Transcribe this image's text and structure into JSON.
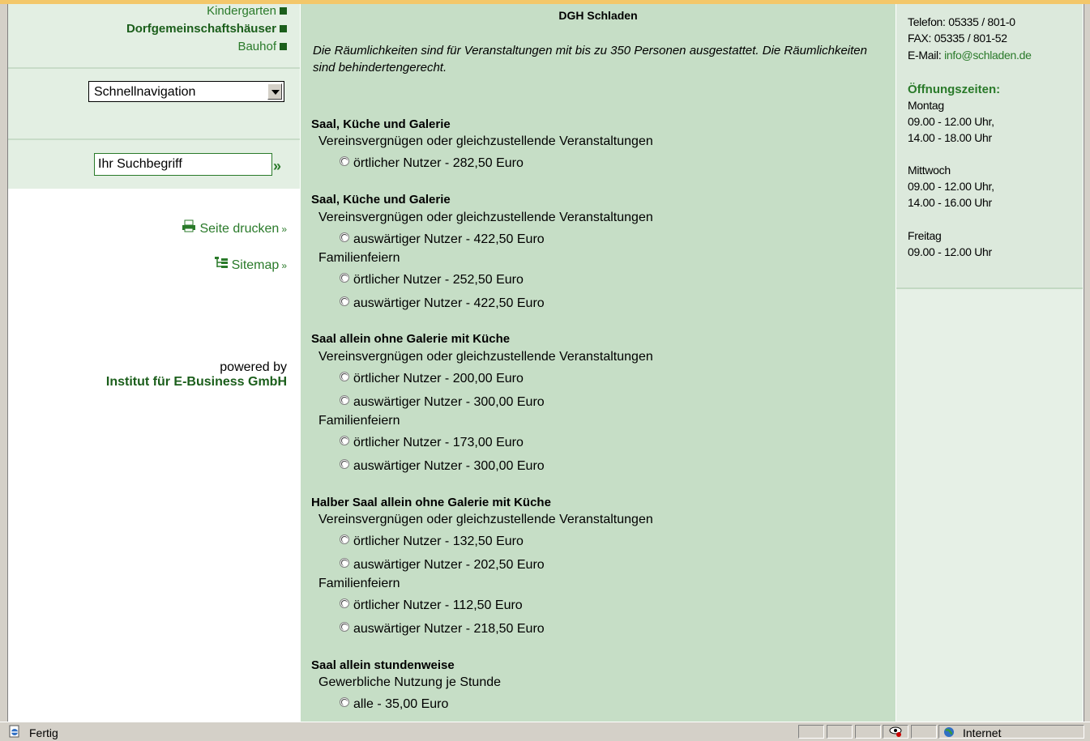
{
  "left_nav": {
    "items": [
      {
        "label": "Kindergarten",
        "active": false
      },
      {
        "label": "Dorfgemeinschaftshäuser",
        "active": true
      },
      {
        "label": "Bauhof",
        "active": false
      }
    ],
    "quick_nav": {
      "selected": "Schnellnavigation"
    },
    "search": {
      "value": "Ihr Suchbegriff",
      "go_label": "»"
    },
    "print_label": "Seite drucken",
    "sitemap_label": "Sitemap",
    "link_suffix": "»",
    "powered_by": "powered by",
    "company": "Institut für E-Business GmbH"
  },
  "content": {
    "title": "DGH Schladen",
    "intro": "Die Räumlichkeiten sind für Veranstaltungen mit bis zu 350 Personen ausgestattet. Die Räumlichkeiten sind behindertengerecht.",
    "sections": [
      {
        "heading": "Saal, Küche und Galerie",
        "sub": "Vereinsvergnügen oder gleichzustellende Veranstaltungen",
        "options": [
          "örtlicher Nutzer - 282,50 Euro"
        ]
      },
      {
        "heading": "Saal, Küche und Galerie",
        "sub": "Vereinsvergnügen oder gleichzustellende Veranstaltungen",
        "options": [
          "auswärtiger Nutzer - 422,50 Euro"
        ],
        "sub2": "Familienfeiern",
        "options2": [
          "örtlicher Nutzer - 252,50 Euro",
          "auswärtiger Nutzer - 422,50 Euro"
        ]
      },
      {
        "heading": "Saal allein ohne Galerie mit Küche",
        "sub": "Vereinsvergnügen oder gleichzustellende Veranstaltungen",
        "options": [
          "örtlicher Nutzer - 200,00 Euro",
          "auswärtiger Nutzer - 300,00 Euro"
        ],
        "sub2": "Familienfeiern",
        "options2": [
          "örtlicher Nutzer - 173,00 Euro",
          "auswärtiger Nutzer - 300,00 Euro"
        ]
      },
      {
        "heading": "Halber Saal allein ohne Galerie mit Küche",
        "sub": "Vereinsvergnügen oder gleichzustellende Veranstaltungen",
        "options": [
          "örtlicher Nutzer - 132,50 Euro",
          "auswärtiger Nutzer - 202,50 Euro"
        ],
        "sub2": "Familienfeiern",
        "options2": [
          "örtlicher Nutzer - 112,50 Euro",
          "auswärtiger Nutzer - 218,50 Euro"
        ]
      },
      {
        "heading": "Saal allein stundenweise",
        "sub": "Gewerbliche Nutzung je Stunde",
        "options": [
          "alle - 35,00 Euro"
        ]
      }
    ]
  },
  "contact": {
    "phone": "Telefon: 05335 / 801-0",
    "fax": "FAX: 05335 / 801-52",
    "email_label": "E-Mail:",
    "email": "info@schladen.de",
    "hours_heading": "Öffnungszeiten:",
    "hours": [
      {
        "day": "Montag",
        "times": [
          "09.00 - 12.00 Uhr,",
          "14.00 - 18.00 Uhr"
        ]
      },
      {
        "day": "Mittwoch",
        "times": [
          "09.00 - 12.00 Uhr,",
          "14.00 - 16.00 Uhr"
        ]
      },
      {
        "day": "Freitag",
        "times": [
          "09.00 - 12.00 Uhr"
        ]
      }
    ]
  },
  "statusbar": {
    "status": "Fertig",
    "zone": "Internet"
  },
  "colors": {
    "nav_green": "#2a7a2a",
    "content_bg": "#c6dec6",
    "panel_bg": "#e3efe3"
  }
}
